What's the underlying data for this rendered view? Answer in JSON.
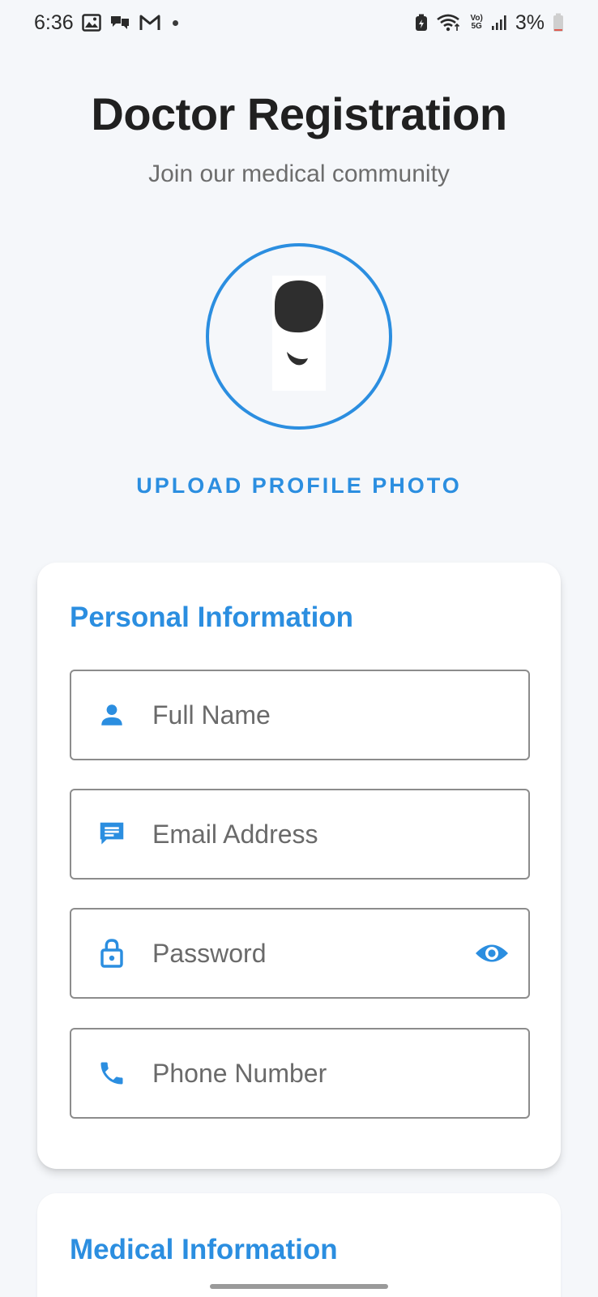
{
  "status_bar": {
    "time": "6:36",
    "volte_top": "Vo)",
    "volte_bottom": "5G",
    "battery_percent": "3%"
  },
  "header": {
    "title": "Doctor Registration",
    "subtitle": "Join our medical community"
  },
  "profile": {
    "upload_label": "UPLOAD PROFILE PHOTO"
  },
  "personal_section": {
    "title": "Personal Information",
    "fields": [
      {
        "placeholder": "Full Name",
        "icon": "person-icon"
      },
      {
        "placeholder": "Email Address",
        "icon": "message-icon"
      },
      {
        "placeholder": "Password",
        "icon": "lock-icon",
        "trailing_icon": "eye-icon"
      },
      {
        "placeholder": "Phone Number",
        "icon": "phone-icon"
      }
    ]
  },
  "medical_section": {
    "title": "Medical Information"
  },
  "colors": {
    "accent": "#2b8ee0",
    "background": "#f5f7fa",
    "card": "#ffffff",
    "field_border": "#8c8c8c",
    "placeholder": "#6a6a6a",
    "title_text": "#202020",
    "subtitle_text": "#6d6d6d"
  }
}
